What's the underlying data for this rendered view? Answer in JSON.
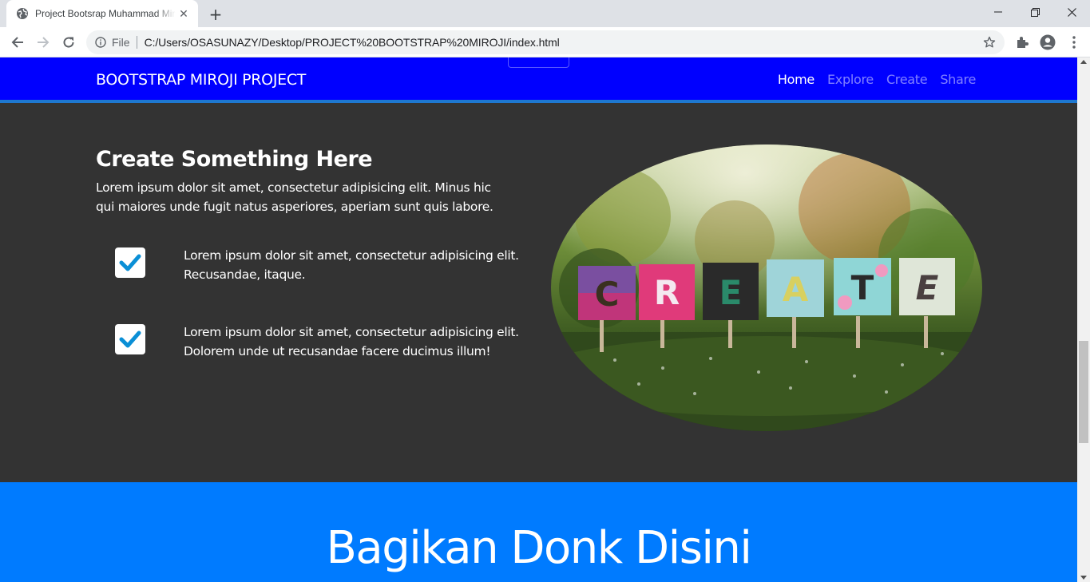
{
  "browser": {
    "tab_title": "Project Bootsrap Muhammad Miroji",
    "address_scheme_label": "File",
    "url": "C:/Users/OSASUNAZY/Desktop/PROJECT%20BOOTSTRAP%20MIROJI/index.html"
  },
  "navbar": {
    "brand": "BOOTSTRAP MIROJI PROJECT",
    "links": [
      {
        "label": "Home",
        "active": true
      },
      {
        "label": "Explore",
        "active": false
      },
      {
        "label": "Create",
        "active": false
      },
      {
        "label": "Share",
        "active": false
      }
    ],
    "bg_color": "#0000ff"
  },
  "feature": {
    "heading": "Create Something Here",
    "lead": "Lorem ipsum dolor sit amet, consectetur adipisicing elit. Minus hic qui maiores unde fugit natus asperiores, aperiam sunt quis labore.",
    "items": [
      {
        "text": "Lorem ipsum dolor sit amet, consectetur adipisicing elit. Recusandae, itaque."
      },
      {
        "text": "Lorem ipsum dolor sit amet, consectetur adipisicing elit. Dolorem unde ut recusandae facere ducimus illum!"
      }
    ],
    "check_color": "#0a8fd6",
    "image_letters": [
      "C",
      "R",
      "E",
      "A",
      "T",
      "E"
    ]
  },
  "share": {
    "heading": "Bagikan Donk Disini",
    "bg_color": "#007bff"
  }
}
